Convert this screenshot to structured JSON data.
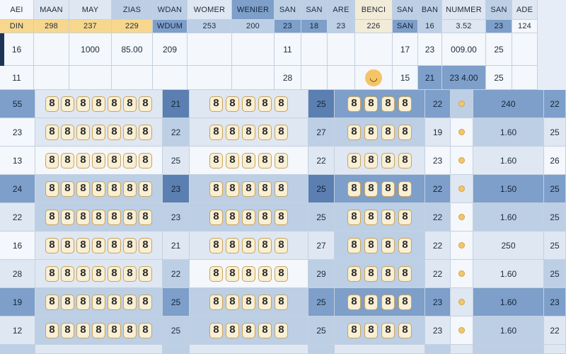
{
  "header_row": [
    "AEI",
    "MAAN",
    "MAY",
    "ZIAS",
    "WDAN",
    "WOMER",
    "WENIER",
    "SAN",
    "SAN",
    "ARE",
    "BENCI",
    "SAN",
    "BAN",
    "NUMMER",
    "SAN",
    "ADE"
  ],
  "subheader_row": [
    "DIN",
    "298",
    "237",
    "229",
    "WDUM",
    "253",
    "200",
    "23",
    "18",
    "23",
    "226",
    "SAN",
    "16",
    "3.52",
    "23",
    "124"
  ],
  "info_rows": [
    [
      "16",
      "",
      "1000",
      "85.00",
      "209",
      "",
      "",
      "11",
      "",
      "",
      "",
      "17",
      "23",
      "009.00",
      "25",
      ""
    ],
    [
      "11",
      "",
      "",
      "",
      "",
      "",
      "",
      "28",
      "",
      "",
      "",
      "15",
      "21",
      "23 4.00",
      "25",
      ""
    ]
  ],
  "data_rows": [
    {
      "id": "55",
      "b": "21",
      "c": "25",
      "d": "22",
      "e": "240",
      "f": "22"
    },
    {
      "id": "23",
      "b": "22",
      "c": "27",
      "d": "19",
      "e": "1.60",
      "f": "25"
    },
    {
      "id": "13",
      "b": "25",
      "c": "22",
      "d": "23",
      "e": "1.60",
      "f": "26"
    },
    {
      "id": "24",
      "b": "23",
      "c": "25",
      "d": "22",
      "e": "1.50",
      "f": "25"
    },
    {
      "id": "22",
      "b": "23",
      "c": "25",
      "d": "22",
      "e": "1.60",
      "f": "25"
    },
    {
      "id": "16",
      "b": "21",
      "c": "27",
      "d": "22",
      "e": "250",
      "f": "25"
    },
    {
      "id": "28",
      "b": "22",
      "c": "29",
      "d": "22",
      "e": "1.60",
      "f": "25"
    },
    {
      "id": "19",
      "b": "25",
      "c": "25",
      "d": "23",
      "e": "1.60",
      "f": "23"
    },
    {
      "id": "12",
      "b": "25",
      "c": "25",
      "d": "23",
      "e": "1.60",
      "f": "22"
    }
  ],
  "digit_glyph": "8",
  "last_col_header": "ADE",
  "colors": {
    "white": "#f4f7fb",
    "light": "#dfe7f2",
    "mid": "#bdcfe4",
    "blue": "#7d9fc9",
    "dark": "#5a7fb0",
    "yellow": "#f7d78d",
    "navy": "#1c3556",
    "digit_bg": "#f8efd4"
  },
  "icons": {
    "emoji_cell": "smiley-icon",
    "status_cell": "dot-icon"
  }
}
